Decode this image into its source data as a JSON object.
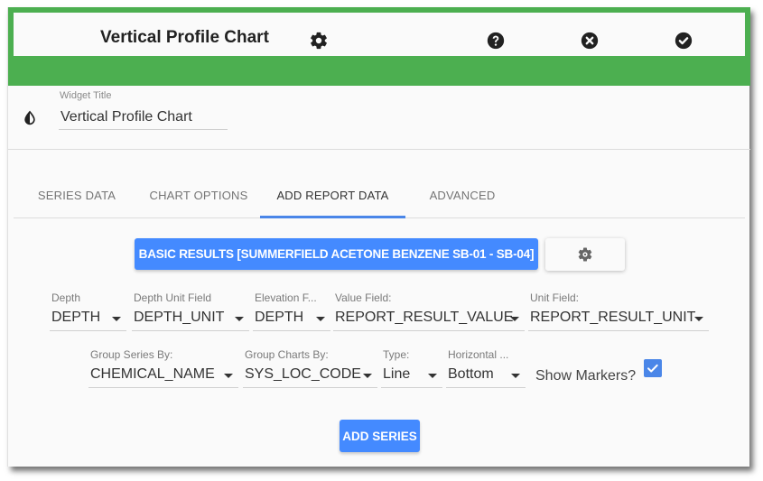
{
  "header": {
    "title": "Vertical Profile Chart",
    "icons": {
      "settings": "gear-icon",
      "help": "help-circle-icon",
      "close": "close-circle-icon",
      "confirm": "check-circle-icon"
    },
    "accent_color": "#4caf50"
  },
  "widget_title": {
    "icon": "contrast-icon",
    "label": "Widget Title",
    "value": "Vertical Profile Chart"
  },
  "tabs": [
    {
      "label": "SERIES DATA",
      "active": false
    },
    {
      "label": "CHART OPTIONS",
      "active": false
    },
    {
      "label": "ADD REPORT DATA",
      "active": true
    },
    {
      "label": "ADVANCED",
      "active": false
    }
  ],
  "report": {
    "button_label": "BASIC RESULTS [SUMMERFIELD ACETONE BENZENE SB-01 - SB-04]",
    "settings_icon": "gear-icon",
    "button_color": "#448aff"
  },
  "fields_row1": [
    {
      "label": "Depth",
      "value": "DEPTH"
    },
    {
      "label": "Depth Unit Field",
      "value": "DEPTH_UNIT"
    },
    {
      "label": "Elevation F...",
      "value": "DEPTH"
    },
    {
      "label": "Value Field:",
      "value": "REPORT_RESULT_VALUE"
    },
    {
      "label": "Unit Field:",
      "value": "REPORT_RESULT_UNIT"
    }
  ],
  "fields_row2": [
    {
      "label": "Group Series By:",
      "value": "CHEMICAL_NAME"
    },
    {
      "label": "Group Charts By:",
      "value": "SYS_LOC_CODE"
    },
    {
      "label": "Type:",
      "value": "Line"
    },
    {
      "label": "Horizontal ...",
      "value": "Bottom"
    }
  ],
  "show_markers": {
    "label": "Show Markers?",
    "checked": true
  },
  "add_series_label": "ADD SERIES"
}
